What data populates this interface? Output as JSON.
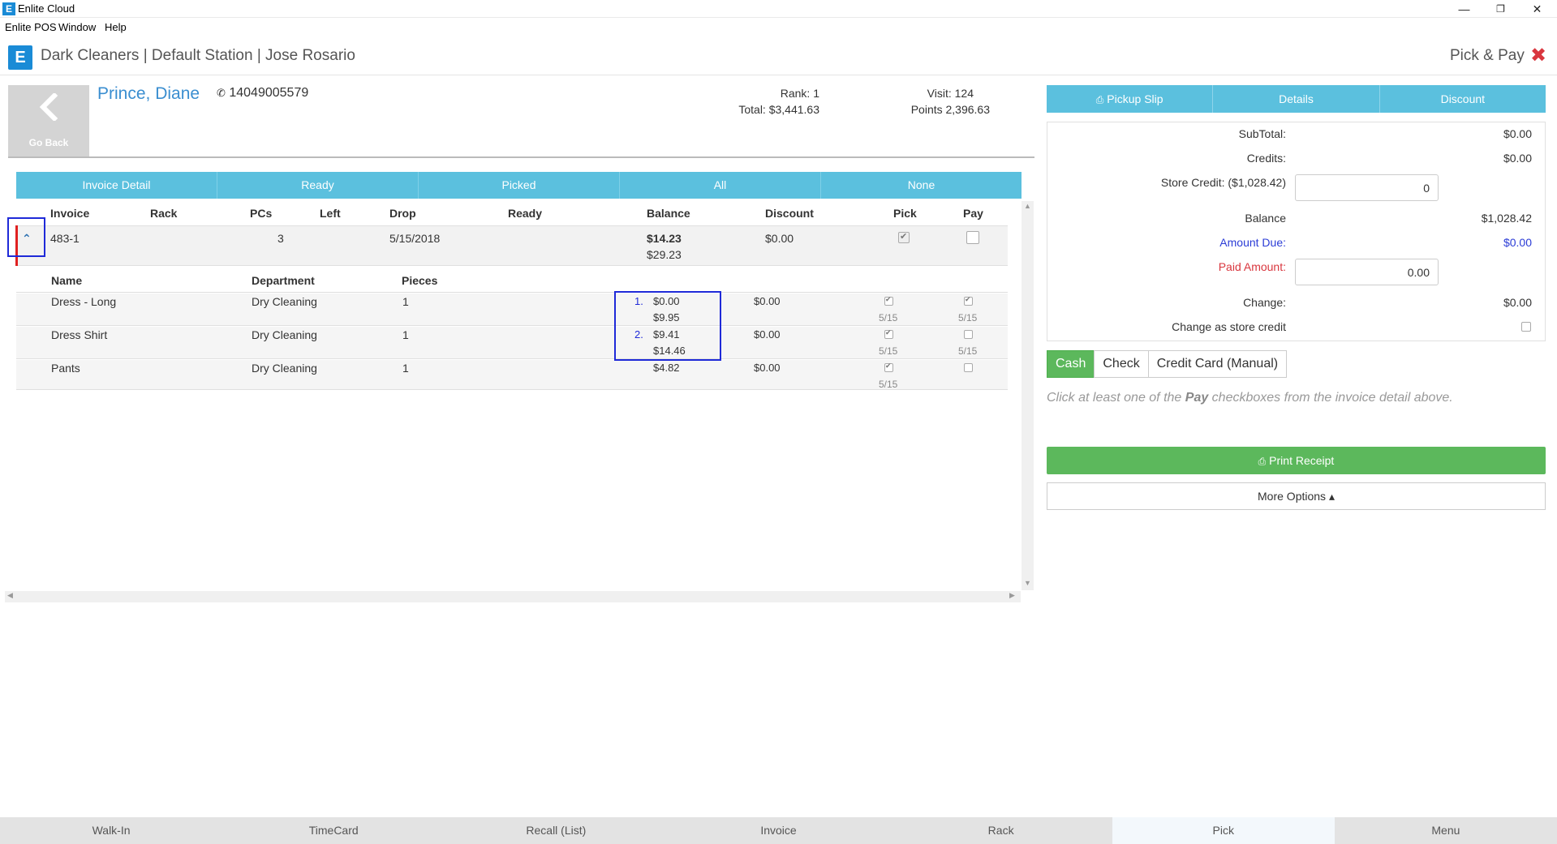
{
  "window": {
    "title": "Enlite Cloud",
    "menu": [
      "Enlite POS",
      "Window",
      "Help"
    ],
    "controls": {
      "minimize": "—",
      "restore": "❐",
      "close": "✕"
    }
  },
  "header": {
    "station_title": "Dark Cleaners | Default Station | Jose Rosario",
    "page_title": "Pick & Pay"
  },
  "customer": {
    "go_back_label": "Go Back",
    "name": "Prince, Diane",
    "phone": "14049005579",
    "rank": "Rank: 1",
    "total": "Total: $3,441.63",
    "visit": "Visit: 124",
    "points": "Points 2,396.63"
  },
  "filter_tabs": [
    "Invoice Detail",
    "Ready",
    "Picked",
    "All",
    "None"
  ],
  "invoice_table": {
    "columns": [
      "Invoice",
      "Rack",
      "PCs",
      "Left",
      "Drop",
      "Ready",
      "Balance",
      "Discount",
      "Pick",
      "Pay"
    ],
    "row": {
      "invoice": "483-1",
      "pcs": "3",
      "drop": "5/15/2018",
      "balance": "$14.23",
      "balance_total": "$29.23",
      "discount": "$0.00",
      "pick_checked": true,
      "pay_checked": false
    },
    "item_columns": [
      "Name",
      "Department",
      "Pieces"
    ],
    "items": [
      {
        "num": "1.",
        "name": "Dress - Long",
        "department": "Dry Cleaning",
        "pieces": "1",
        "balance": "$0.00",
        "balance_total": "$9.95",
        "discount": "$0.00",
        "pick_date": "5/15",
        "pay_date": "5/15",
        "pick": true,
        "pay": true
      },
      {
        "num": "2.",
        "name": "Dress Shirt",
        "department": "Dry Cleaning",
        "pieces": "1",
        "balance": "$9.41",
        "balance_total": "$14.46",
        "discount": "$0.00",
        "pick_date": "5/15",
        "pay_date": "5/15",
        "pick": true,
        "pay": false
      },
      {
        "num": "",
        "name": "Pants",
        "department": "Dry Cleaning",
        "pieces": "1",
        "balance": "$4.82",
        "balance_total": "",
        "discount": "$0.00",
        "pick_date": "5/15",
        "pay_date": "",
        "pick": true,
        "pay": false
      }
    ]
  },
  "right_tabs": [
    "Pickup Slip",
    "Details",
    "Discount"
  ],
  "summary": {
    "subtotal_label": "SubTotal:",
    "subtotal": "$0.00",
    "credits_label": "Credits:",
    "credits": "$0.00",
    "store_credit_label": "Store Credit: ($1,028.42)",
    "store_credit_value": "0",
    "balance_label": "Balance",
    "balance": "$1,028.42",
    "amount_due_label": "Amount Due:",
    "amount_due": "$0.00",
    "paid_amount_label": "Paid Amount:",
    "paid_amount_value": "0.00",
    "change_label": "Change:",
    "change": "$0.00",
    "change_store_credit_label": "Change as store credit"
  },
  "payment_methods": [
    "Cash",
    "Check",
    "Credit Card (Manual)"
  ],
  "hint": {
    "before": "Click at least one of the ",
    "bold": "Pay",
    "after": " checkboxes from the invoice detail above."
  },
  "print_receipt": "Print Receipt",
  "more_options": "More Options ▴",
  "bottom_nav": [
    "Walk-In",
    "TimeCard",
    "Recall (List)",
    "Invoice",
    "Rack",
    "Pick",
    "Menu"
  ],
  "colors": {
    "accent": "#5bc0de",
    "brand": "#1a8bd6",
    "success": "#5cb85c",
    "danger": "#d9363e",
    "link": "#3a8ed0"
  }
}
